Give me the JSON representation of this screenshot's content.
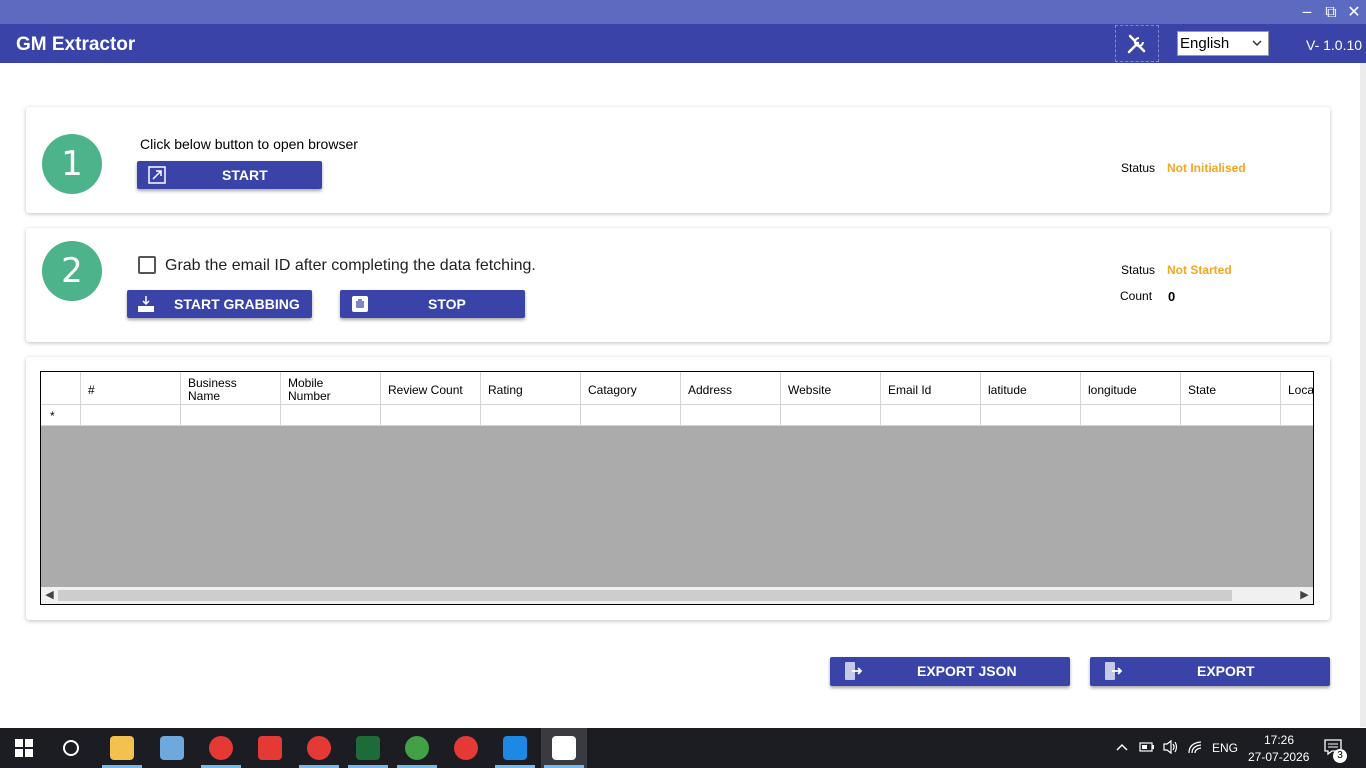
{
  "app": {
    "title": "GM Extractor",
    "version": "V- 1.0.10",
    "language_selected": "English"
  },
  "window_controls": {
    "minimize": "‒",
    "maximize": "⧉",
    "close": "✕"
  },
  "step1": {
    "number": "1",
    "instruction": "Click below button to open browser",
    "start_label": "START",
    "status_label": "Status",
    "status_value": "Not Initialised"
  },
  "step2": {
    "number": "2",
    "checkbox_label": "Grab the email ID after completing the data fetching.",
    "start_grabbing_label": "START GRABBING",
    "stop_label": "STOP",
    "status_label": "Status",
    "status_value": "Not Started",
    "count_label": "Count",
    "count_value": "0"
  },
  "grid": {
    "columns": [
      "#",
      "Business\nName",
      "Mobile\nNumber",
      "Review Count",
      "Rating",
      "Catagory",
      "Address",
      "Website",
      "Email Id",
      "latitude",
      "longitude",
      "State",
      "Location"
    ],
    "new_row_marker": "*"
  },
  "footer": {
    "export_json_label": "EXPORT JSON",
    "export_label": "EXPORT"
  },
  "taskbar": {
    "lang": "ENG",
    "time": "17:26",
    "date": "27-07-2026",
    "notification_count": "3"
  },
  "colors": {
    "accent": "#3a44a8",
    "title_bar": "#5c6bc0",
    "step_circle": "#4db38a",
    "status_warning": "#f5a623"
  }
}
